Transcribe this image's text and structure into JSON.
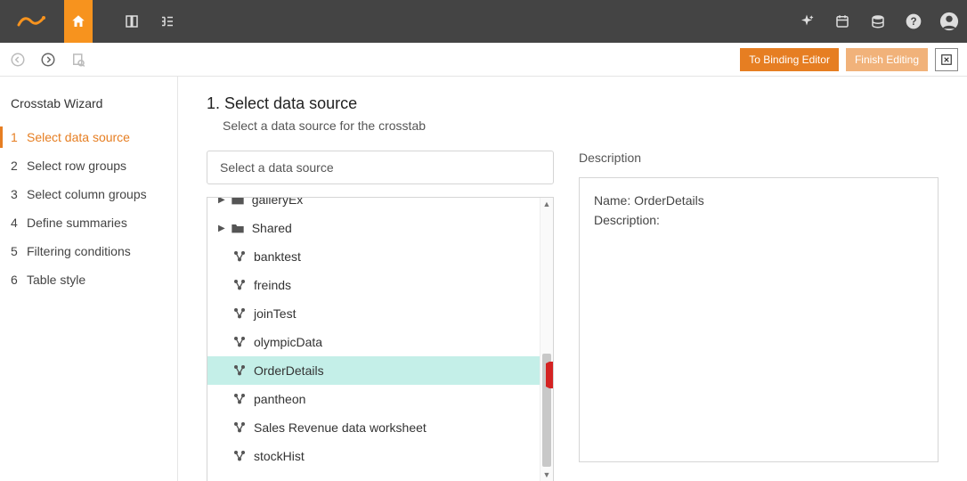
{
  "topbar": {
    "logo": "logo",
    "home": "home"
  },
  "toolbar": {
    "to_binding": "To Binding Editor",
    "finish_editing": "Finish Editing"
  },
  "wizard": {
    "title": "Crosstab Wizard",
    "steps": [
      {
        "num": "1",
        "label": "Select data source",
        "active": true
      },
      {
        "num": "2",
        "label": "Select row groups"
      },
      {
        "num": "3",
        "label": "Select column groups"
      },
      {
        "num": "4",
        "label": "Define summaries"
      },
      {
        "num": "5",
        "label": "Filtering conditions"
      },
      {
        "num": "6",
        "label": "Table style"
      }
    ]
  },
  "main": {
    "heading": "1. Select data source",
    "sub": "Select a data source for the crosstab",
    "search_placeholder": "Select a data source",
    "tree": {
      "folders": [
        {
          "label": "galleryEx"
        },
        {
          "label": "Shared"
        }
      ],
      "items": [
        {
          "label": "banktest"
        },
        {
          "label": "freinds"
        },
        {
          "label": "joinTest"
        },
        {
          "label": "olympicData"
        },
        {
          "label": "OrderDetails",
          "selected": true
        },
        {
          "label": "pantheon"
        },
        {
          "label": "Sales Revenue data worksheet"
        },
        {
          "label": "stockHist"
        }
      ]
    },
    "desc": {
      "label": "Description",
      "name_label": "Name:",
      "name_value": "OrderDetails",
      "desc_label": "Description:",
      "desc_value": ""
    }
  }
}
